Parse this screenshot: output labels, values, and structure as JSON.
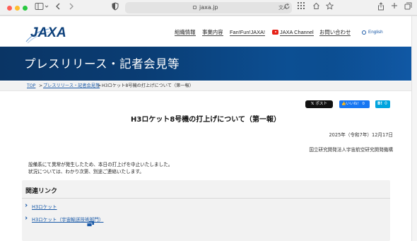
{
  "browser": {
    "url": "jaxa.jp",
    "translate_label": "文A"
  },
  "header": {
    "logo_text": "JAXA",
    "nav": [
      {
        "label": "組織情報"
      },
      {
        "label": "事業内容"
      },
      {
        "label": "Fan!Fun!JAXA!"
      },
      {
        "label": "JAXA Channel"
      },
      {
        "label": "お問い合わせ"
      }
    ],
    "language": "English"
  },
  "banner": {
    "title": "プレスリリース・記者会見等",
    "color": "#0b3f7a"
  },
  "breadcrumb": {
    "items": [
      {
        "label": "TOP"
      },
      {
        "label": "プレスリリース・記者会見等"
      },
      {
        "label": "H3ロケット8号機の打上げについて（第一報）"
      }
    ],
    "separator": ">"
  },
  "share": {
    "x_post": "ポスト",
    "facebook_like": "いいね！ 0",
    "hatena": "0"
  },
  "article": {
    "title": "H3ロケット8号機の打上げについて（第一報）",
    "date": "2025年（令和7年）12月17日",
    "org": "国立研究開発法人宇宙航空研究開発機構",
    "paragraphs": [
      "設備系にて異常が発生したため、本日の打上げを中止いたしました。",
      "状況については、わかり次第、別途ご連絡いたします。"
    ]
  },
  "related": {
    "title": "関連リンク",
    "links": [
      {
        "label": "H3ロケット"
      },
      {
        "label": "H3ロケット（宇宙輸送技術部門）"
      }
    ]
  },
  "colors": {
    "brand_blue": "#0b3f7a",
    "link_blue": "#1a5aa8",
    "youtube_red": "#e62117",
    "facebook_blue": "#1877f2",
    "hatena_blue": "#00a4de"
  }
}
